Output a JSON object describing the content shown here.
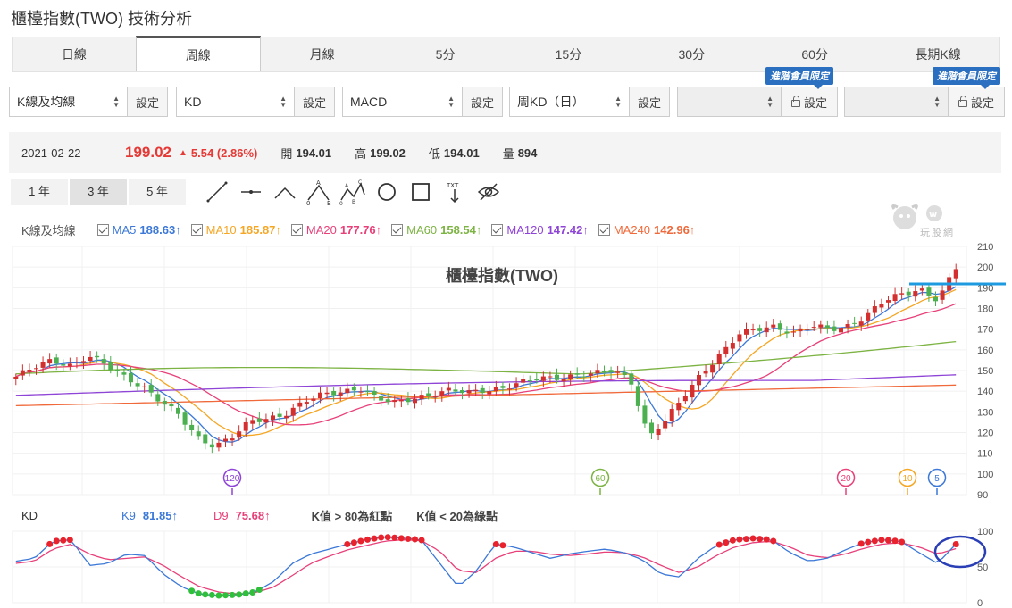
{
  "page": {
    "title": "櫃檯指數(TWO) 技術分析"
  },
  "tabs": [
    "日線",
    "周線",
    "月線",
    "5分",
    "15分",
    "30分",
    "60分",
    "長期K線"
  ],
  "active_tab": "周線",
  "selectors": [
    {
      "value": "K線及均線",
      "button": "設定"
    },
    {
      "value": "KD",
      "button": "設定"
    },
    {
      "value": "MACD",
      "button": "設定"
    },
    {
      "value": "周KD（日）",
      "button": "設定"
    },
    {
      "value": "",
      "button": "設定",
      "badge": "進階會員限定"
    },
    {
      "value": "",
      "button": "設定",
      "badge": "進階會員限定"
    }
  ],
  "quote": {
    "date": "2021-02-22",
    "price": "199.02",
    "change": "5.54 (2.86%)",
    "open_label": "開",
    "open": "194.01",
    "high_label": "高",
    "high": "199.02",
    "low_label": "低",
    "low": "194.01",
    "volume_label": "量",
    "volume": "894"
  },
  "ranges": [
    "1 年",
    "3 年",
    "5 年"
  ],
  "active_range": "3 年",
  "tools": [
    "line-tool-icon",
    "horizontal-line-tool-icon",
    "angle-tool-icon",
    "abc-pattern-tool-icon",
    "abcd-pattern-tool-icon",
    "circle-tool-icon",
    "rectangle-tool-icon",
    "text-tool-icon",
    "hide-drawings-icon"
  ],
  "ma_legend": {
    "title": "K線及均線",
    "items": [
      {
        "label": "MA5",
        "value": "188.63↑",
        "color": "#3b78d8"
      },
      {
        "label": "MA10",
        "value": "185.87↑",
        "color": "#f5a623"
      },
      {
        "label": "MA20",
        "value": "177.76↑",
        "color": "#e8407a"
      },
      {
        "label": "MA60",
        "value": "158.54↑",
        "color": "#7cb342"
      },
      {
        "label": "MA120",
        "value": "147.42↑",
        "color": "#8e44d6"
      },
      {
        "label": "MA240",
        "value": "142.96↑",
        "color": "#f0693a"
      }
    ]
  },
  "logo_text": "玩股網",
  "kd_legend": {
    "title": "KD",
    "k_label": "K9",
    "k_value": "81.85↑",
    "k_color": "#3b78d8",
    "d_label": "D9",
    "d_value": "75.68↑",
    "d_color": "#e8407a",
    "note1": "K值 > 80為紅點",
    "note2": "K值 < 20為綠點"
  },
  "chart_data": [
    {
      "type": "candlestick",
      "title": "櫃檯指數(TWO)",
      "ylim": [
        90,
        210
      ],
      "y_ticks": [
        90,
        100,
        110,
        120,
        130,
        140,
        150,
        160,
        170,
        180,
        190,
        200,
        210
      ],
      "grid": true,
      "ma_markers": [
        {
          "label": "120",
          "color": "#8e44d6"
        },
        {
          "label": "60",
          "color": "#7cb342"
        },
        {
          "label": "20",
          "color": "#e8407a"
        },
        {
          "label": "10",
          "color": "#f5a623"
        },
        {
          "label": "5",
          "color": "#3b78d8"
        }
      ],
      "resistance_line": {
        "value": 191,
        "color": "#1e9be0"
      },
      "close_anchors": [
        147,
        151,
        155,
        153,
        157,
        152,
        147,
        143,
        135,
        128,
        118,
        114,
        118,
        125,
        127,
        130,
        135,
        138,
        140,
        142,
        136,
        134,
        137,
        139,
        140,
        139,
        141,
        142,
        144,
        146,
        147,
        148,
        148,
        150,
        146,
        118,
        126,
        138,
        150,
        158,
        167,
        170,
        172,
        168,
        171,
        170,
        172,
        176,
        183,
        187,
        190,
        184,
        199.02
      ]
    },
    {
      "type": "line",
      "title": "KD",
      "ylim": [
        0,
        100
      ],
      "y_ticks": [
        0,
        50,
        100
      ],
      "series": [
        {
          "name": "K9",
          "color": "#3b78d8"
        },
        {
          "name": "D9",
          "color": "#e8407a"
        }
      ],
      "k_anchors": [
        58,
        62,
        86,
        88,
        52,
        55,
        68,
        66,
        40,
        22,
        12,
        10,
        11,
        15,
        30,
        55,
        68,
        75,
        82,
        88,
        92,
        90,
        88,
        55,
        22,
        45,
        82,
        78,
        70,
        62,
        68,
        72,
        75,
        70,
        60,
        40,
        36,
        62,
        80,
        88,
        90,
        88,
        70,
        58,
        62,
        74,
        84,
        88,
        86,
        70,
        55,
        81.85
      ],
      "d_anchors": [
        55,
        58,
        75,
        82,
        68,
        60,
        62,
        64,
        52,
        36,
        22,
        15,
        12,
        14,
        22,
        38,
        55,
        65,
        74,
        80,
        86,
        88,
        87,
        72,
        45,
        42,
        62,
        72,
        72,
        68,
        66,
        68,
        71,
        70,
        64,
        52,
        42,
        50,
        66,
        78,
        84,
        86,
        78,
        66,
        63,
        68,
        76,
        82,
        84,
        78,
        68,
        75.68
      ]
    }
  ]
}
